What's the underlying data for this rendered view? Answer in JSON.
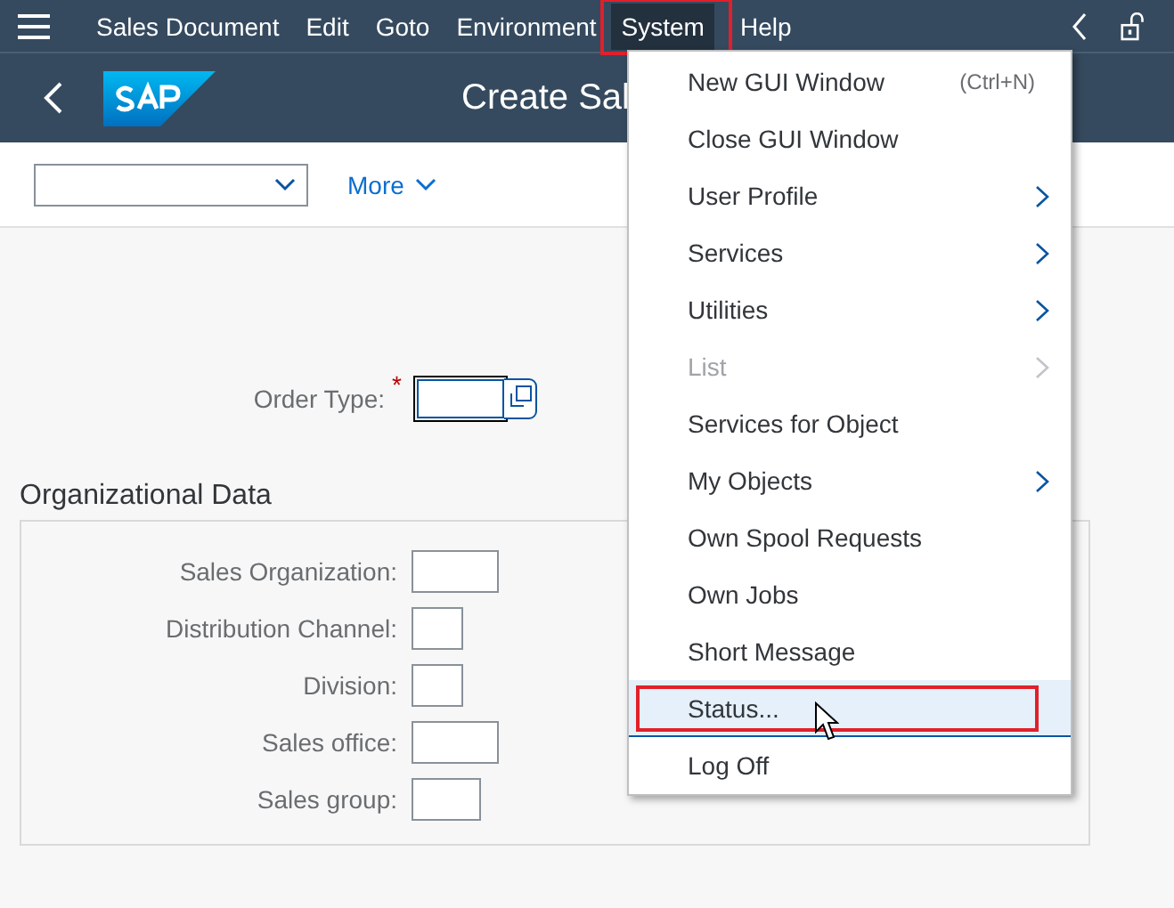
{
  "menu_bar": {
    "items": [
      {
        "label": "Sales Document",
        "selected": false,
        "annotated": false
      },
      {
        "label": "Edit",
        "selected": false,
        "annotated": false
      },
      {
        "label": "Goto",
        "selected": false,
        "annotated": false
      },
      {
        "label": "Environment",
        "selected": false,
        "annotated": false
      },
      {
        "label": "System",
        "selected": true,
        "annotated": true
      },
      {
        "label": "Help",
        "selected": false,
        "annotated": false
      }
    ]
  },
  "header": {
    "title": "Create Sal"
  },
  "toolbar": {
    "more_label": "More"
  },
  "order_type": {
    "label": "Order Type:",
    "required_mark": "*"
  },
  "organizational_data": {
    "title": "Organizational Data",
    "fields": [
      {
        "label": "Sales Organization:"
      },
      {
        "label": "Distribution Channel:"
      },
      {
        "label": "Division:"
      },
      {
        "label": "Sales office:"
      },
      {
        "label": "Sales group:"
      }
    ]
  },
  "system_menu": {
    "items": [
      {
        "label": "New GUI Window",
        "shortcut": "(Ctrl+N)",
        "submenu": false,
        "disabled": false,
        "highlighted": false,
        "annotated": false
      },
      {
        "label": "Close GUI Window",
        "submenu": false,
        "disabled": false,
        "highlighted": false,
        "annotated": false
      },
      {
        "label": "User Profile",
        "submenu": true,
        "disabled": false,
        "highlighted": false,
        "annotated": false
      },
      {
        "label": "Services",
        "submenu": true,
        "disabled": false,
        "highlighted": false,
        "annotated": false
      },
      {
        "label": "Utilities",
        "submenu": true,
        "disabled": false,
        "highlighted": false,
        "annotated": false
      },
      {
        "label": "List",
        "submenu": true,
        "disabled": true,
        "highlighted": false,
        "annotated": false
      },
      {
        "label": "Services for Object",
        "submenu": false,
        "disabled": false,
        "highlighted": false,
        "annotated": false
      },
      {
        "label": "My Objects",
        "submenu": true,
        "disabled": false,
        "highlighted": false,
        "annotated": false
      },
      {
        "label": "Own Spool Requests",
        "submenu": false,
        "disabled": false,
        "highlighted": false,
        "annotated": false
      },
      {
        "label": "Own Jobs",
        "submenu": false,
        "disabled": false,
        "highlighted": false,
        "annotated": false
      },
      {
        "label": "Short Message",
        "submenu": false,
        "disabled": false,
        "highlighted": false,
        "annotated": false
      },
      {
        "label": "Status...",
        "submenu": false,
        "disabled": false,
        "highlighted": true,
        "annotated": true
      },
      {
        "label": "Log Off",
        "submenu": false,
        "disabled": false,
        "highlighted": false,
        "annotated": false
      }
    ]
  }
}
